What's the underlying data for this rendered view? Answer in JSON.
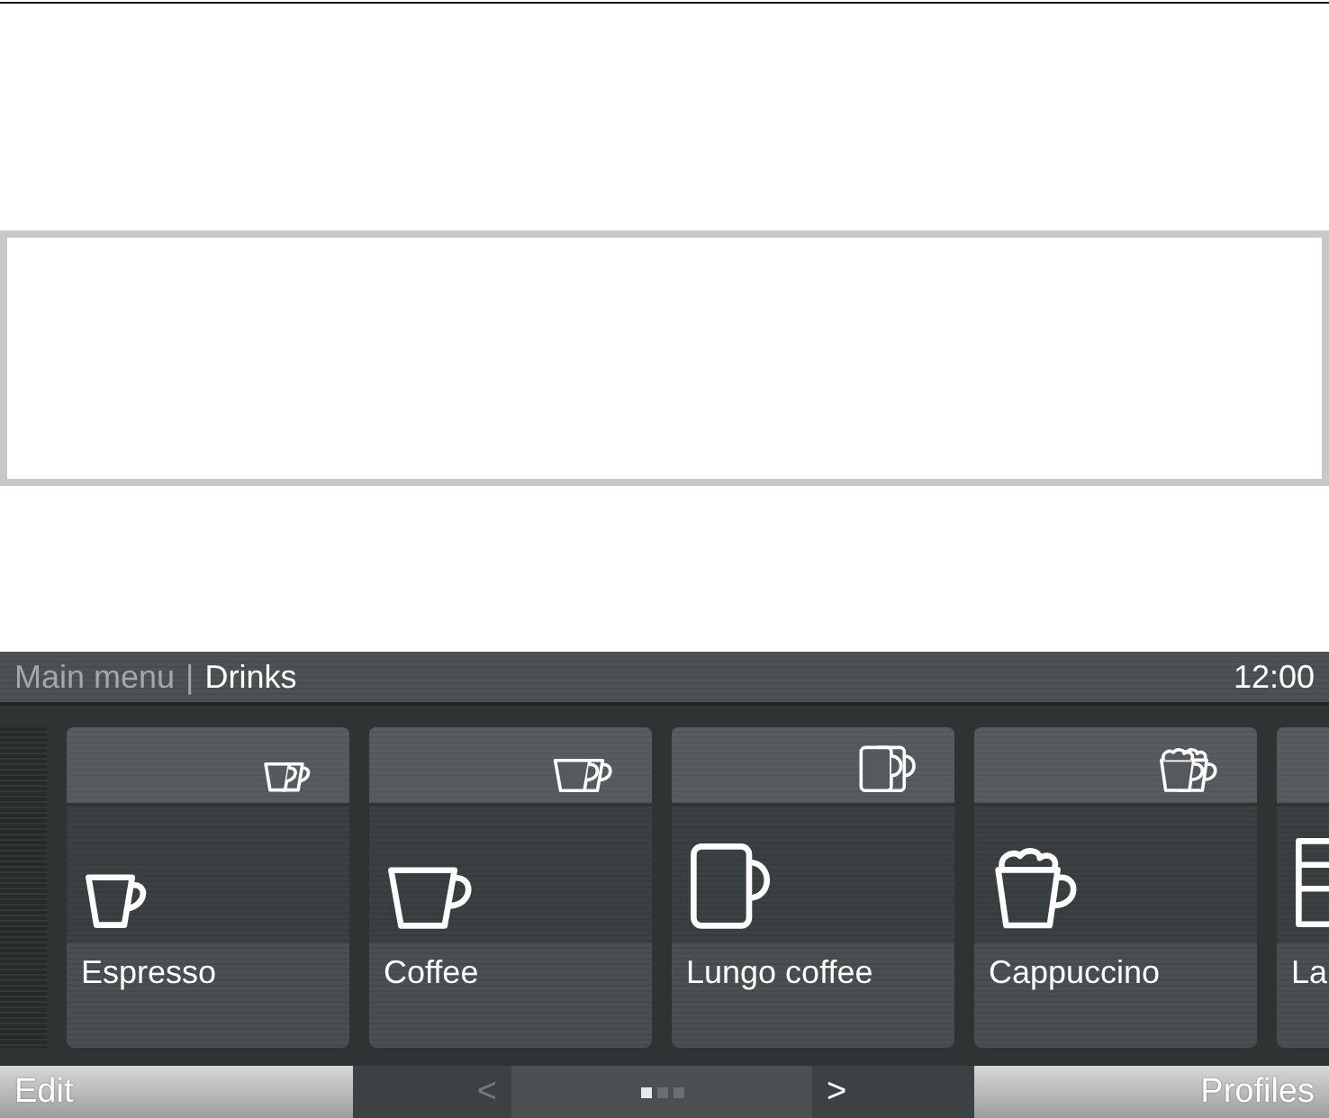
{
  "header": {
    "breadcrumb": "Main menu",
    "separator": "|",
    "current": "Drinks",
    "time": "12:00"
  },
  "tiles": [
    {
      "kind": "espresso",
      "label": "Espresso"
    },
    {
      "kind": "coffee",
      "label": "Coffee"
    },
    {
      "kind": "lungo",
      "label": "Lungo coffee"
    },
    {
      "kind": "cappuccino",
      "label": "Cappuccino"
    },
    {
      "kind": "latte",
      "label": "La"
    }
  ],
  "footer": {
    "left": "Edit",
    "prev": "<",
    "next": ">",
    "right": "Profiles",
    "pages": [
      {
        "selected": true
      },
      {
        "selected": false
      },
      {
        "selected": false
      }
    ]
  }
}
